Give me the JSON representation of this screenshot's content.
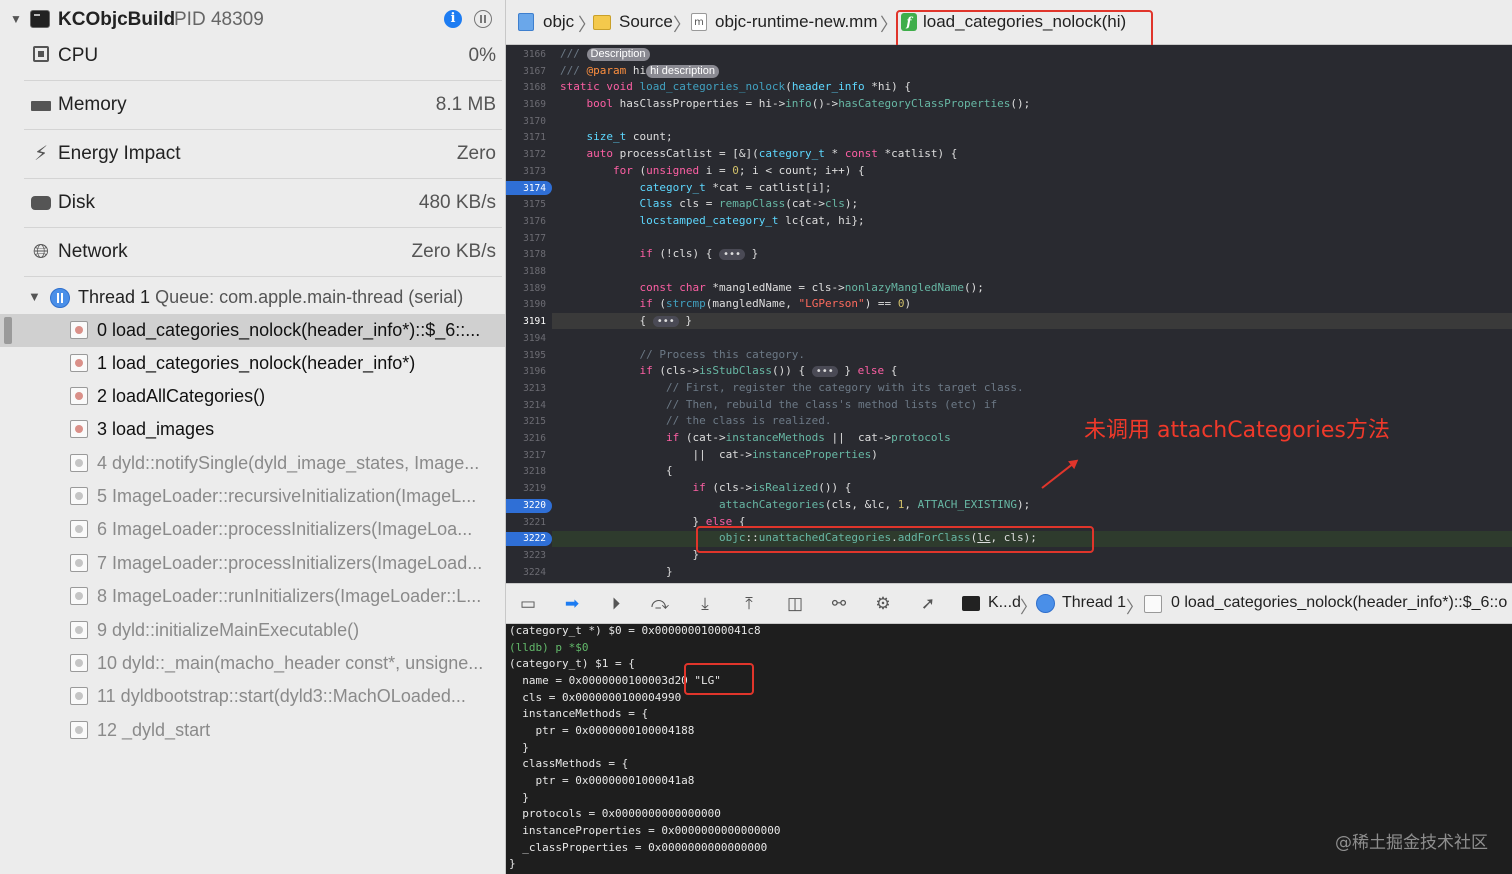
{
  "process": {
    "name": "KCObjcBuild",
    "pid": "PID 48309"
  },
  "gauges": [
    {
      "label": "CPU",
      "value": "0%",
      "icon": "cpu-icon"
    },
    {
      "label": "Memory",
      "value": "8.1 MB",
      "icon": "memory-icon"
    },
    {
      "label": "Energy Impact",
      "value": "Zero",
      "icon": "bolt-icon"
    },
    {
      "label": "Disk",
      "value": "480 KB/s",
      "icon": "disk-icon"
    },
    {
      "label": "Network",
      "value": "Zero KB/s",
      "icon": "globe-icon"
    }
  ],
  "thread": {
    "name": "Thread 1",
    "queue": "Queue: com.apple.main-thread (serial)"
  },
  "frames": [
    "0 load_categories_nolock(header_info*)::$_6::...",
    "1 load_categories_nolock(header_info*)",
    "2 loadAllCategories()",
    "3 load_images",
    "4 dyld::notifySingle(dyld_image_states, Image...",
    "5 ImageLoader::recursiveInitialization(ImageL...",
    "6 ImageLoader::processInitializers(ImageLoa...",
    "7 ImageLoader::processInitializers(ImageLoad...",
    "8 ImageLoader::runInitializers(ImageLoader::L...",
    "9 dyld::initializeMainExecutable()",
    "10 dyld::_main(macho_header const*, unsigne...",
    "11 dyldbootstrap::start(dyld3::MachOLoaded...",
    "12 _dyld_start"
  ],
  "breadcrumb": {
    "project": "objc",
    "folder": "Source",
    "file": "objc-runtime-new.mm",
    "function": "load_categories_nolock(hi)"
  },
  "editor": {
    "line_numbers": [
      "3166",
      "3167",
      "3168",
      "3169",
      "3170",
      "3171",
      "3172",
      "3173",
      "3174",
      "3175",
      "3176",
      "3177",
      "3178",
      "3188",
      "3189",
      "3190",
      "3191",
      "3194",
      "3195",
      "3196",
      "3213",
      "3214",
      "3215",
      "3216",
      "3217",
      "3218",
      "3219",
      "3220",
      "3221",
      "3222",
      "3223",
      "3224"
    ],
    "highlighted_lines": [
      "3174",
      "3191",
      "3220",
      "3222"
    ],
    "badge_description": "Description",
    "badge_hi_description": "hi description",
    "fold_dots": "•••"
  },
  "annotation": "未调用 attachCategories方法",
  "debugbar": {
    "process": "K...d",
    "thread": "Thread 1",
    "frame": "0 load_categories_nolock(header_info*)::$_6::o"
  },
  "console": [
    "(category_t *) $0 = 0x00000001000041c8",
    "(lldb) p *$0",
    "(category_t) $1 = {",
    "  name = 0x0000000100003d20 \"LG\"",
    "  cls = 0x0000000100004990",
    "  instanceMethods = {",
    "    ptr = 0x0000000100004188",
    "  }",
    "  classMethods = {",
    "    ptr = 0x00000001000041a8",
    "  }",
    "  protocols = 0x0000000000000000",
    "  instanceProperties = 0x0000000000000000",
    "  _classProperties = 0x0000000000000000",
    "}"
  ],
  "watermark": "@稀土掘金技术社区",
  "colors": {
    "annotation_red": "#e0352b",
    "accent_blue": "#1d7cf2"
  }
}
